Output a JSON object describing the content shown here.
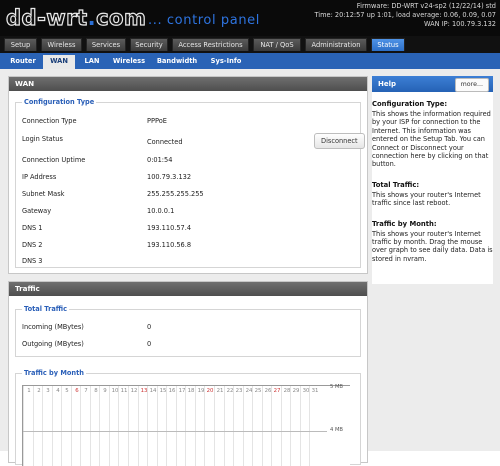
{
  "header": {
    "logo": "dd-wrt",
    "logo_dot": ".",
    "logo_suffix": "com",
    "subtitle": "... control panel",
    "firmware": "Firmware: DD-WRT v24-sp2 (12/22/14) std",
    "time": "Time: 20:12:57 up 1:01, load average: 0.06, 0.09, 0.07",
    "wan_ip": "WAN IP: 100.79.3.132"
  },
  "main_tabs": [
    "Setup",
    "Wireless",
    "Services",
    "Security",
    "Access Restrictions",
    "NAT / QoS",
    "Administration",
    "Status"
  ],
  "main_tabs_active": "Status",
  "sub_tabs": [
    "Router",
    "WAN",
    "LAN",
    "Wireless",
    "Bandwidth",
    "Sys-Info"
  ],
  "sub_tabs_active": "WAN",
  "wan": {
    "title": "WAN",
    "config_legend": "Configuration Type",
    "rows": [
      {
        "label": "Connection Type",
        "value": "PPPoE"
      },
      {
        "label": "Login Status",
        "value": "Connected"
      },
      {
        "label": "Connection Uptime",
        "value": "0:01:54"
      },
      {
        "label": "IP Address",
        "value": "100.79.3.132"
      },
      {
        "label": "Subnet Mask",
        "value": "255.255.255.255"
      },
      {
        "label": "Gateway",
        "value": "10.0.0.1"
      },
      {
        "label": "DNS 1",
        "value": "193.110.57.4"
      },
      {
        "label": "DNS 2",
        "value": "193.110.56.8"
      },
      {
        "label": "DNS 3",
        "value": ""
      }
    ],
    "disconnect_label": "Disconnect"
  },
  "traffic": {
    "title": "Traffic",
    "total_legend": "Total Traffic",
    "rows": [
      {
        "label": "Incoming (MBytes)",
        "value": "0"
      },
      {
        "label": "Outgoing (MBytes)",
        "value": "0"
      }
    ],
    "month_legend": "Traffic by Month",
    "day_numbers": [
      "1",
      "2",
      "3",
      "4",
      "5",
      "6",
      "7",
      "8",
      "9",
      "10",
      "11",
      "12",
      "13",
      "14",
      "15",
      "16",
      "17",
      "18",
      "19",
      "20",
      "21",
      "22",
      "23",
      "24",
      "25",
      "26",
      "27",
      "28",
      "29",
      "30",
      "31"
    ],
    "red_days": [
      "6",
      "13",
      "20",
      "27"
    ],
    "y_labels": [
      "5 MB",
      "4 MB"
    ]
  },
  "help": {
    "title": "Help",
    "more": "more...",
    "sections": [
      {
        "heading": "Configuration Type:",
        "text": "This shows the information required by your ISP for connection to the Internet. This information was entered on the Setup Tab. You can Connect or Disconnect your connection here by clicking on that button."
      },
      {
        "heading": "Total Traffic:",
        "text": "This shows your router's Internet traffic since last reboot."
      },
      {
        "heading": "Traffic by Month:",
        "text": "This shows your router's Internet traffic by month. Drag the mouse over graph to see daily data. Data is stored in nvram."
      }
    ]
  },
  "colors": {
    "accent_blue": "#2e74e0",
    "tab_active": "#2c6ec7",
    "header_bg": "#0a0a0a",
    "red_day": "#cc3333"
  }
}
